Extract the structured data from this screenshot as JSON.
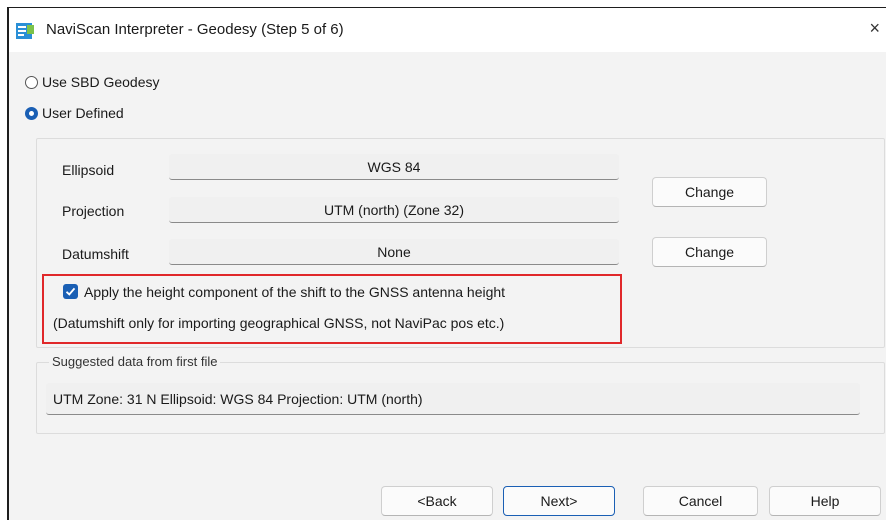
{
  "window": {
    "title": "NaviScan Interpreter - Geodesy (Step 5 of 6)",
    "close_glyph": "×",
    "icon": "app-icon"
  },
  "geodesy_options": {
    "use_sbd": "Use SBD Geodesy",
    "user_defined": "User Defined",
    "selected": "User Defined"
  },
  "settings": {
    "ellipsoid_label": "Ellipsoid",
    "ellipsoid_value": "WGS 84",
    "projection_label": "Projection",
    "projection_value": "UTM (north)  (Zone 32)",
    "datumshift_label": "Datumshift",
    "datumshift_value": "None",
    "change_label": "Change"
  },
  "height_option": {
    "checked": true,
    "label": "Apply the height component of the shift to the GNSS antenna height",
    "note": "(Datumshift only for importing geographical GNSS, not NaviPac pos etc.)"
  },
  "suggested": {
    "title": "Suggested data from first file",
    "text": "UTM Zone: 31 N  Ellipsoid: WGS 84  Projection: UTM (north)"
  },
  "footer": {
    "back": "<Back",
    "next": "Next>",
    "cancel": "Cancel",
    "help": "Help"
  },
  "colors": {
    "accent": "#1a5fb4",
    "highlight": "#e0282a"
  }
}
